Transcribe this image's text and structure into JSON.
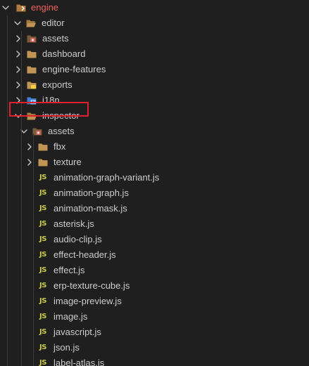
{
  "root": {
    "label": "engine",
    "color": "#f0605a"
  },
  "tree": [
    {
      "label": "editor",
      "chevron": "down",
      "icon": "folder-open-icon",
      "depth": 1
    },
    {
      "label": "assets",
      "chevron": "right",
      "icon": "assets-folder-icon",
      "depth": 2
    },
    {
      "label": "dashboard",
      "chevron": "right",
      "icon": "folder-icon",
      "depth": 2
    },
    {
      "label": "engine-features",
      "chevron": "right",
      "icon": "folder-icon",
      "depth": 2
    },
    {
      "label": "exports",
      "chevron": "right",
      "icon": "exports-folder-icon",
      "depth": 2
    },
    {
      "label": "i18n",
      "chevron": "right",
      "icon": "i18n-folder-icon",
      "depth": 2
    },
    {
      "label": "inspector",
      "chevron": "down",
      "icon": "folder-open-icon",
      "depth": 2,
      "highlighted": true
    },
    {
      "label": "assets",
      "chevron": "down",
      "icon": "assets-folder-icon",
      "depth": 3
    },
    {
      "label": "fbx",
      "chevron": "right",
      "icon": "folder-icon",
      "depth": 4
    },
    {
      "label": "texture",
      "chevron": "right",
      "icon": "folder-icon",
      "depth": 4
    },
    {
      "label": "animation-graph-variant.js",
      "icon": "js-file-icon",
      "depth": 4
    },
    {
      "label": "animation-graph.js",
      "icon": "js-file-icon",
      "depth": 4
    },
    {
      "label": "animation-mask.js",
      "icon": "js-file-icon",
      "depth": 4
    },
    {
      "label": "asterisk.js",
      "icon": "js-file-icon",
      "depth": 4
    },
    {
      "label": "audio-clip.js",
      "icon": "js-file-icon",
      "depth": 4
    },
    {
      "label": "effect-header.js",
      "icon": "js-file-icon",
      "depth": 4
    },
    {
      "label": "effect.js",
      "icon": "js-file-icon",
      "depth": 4
    },
    {
      "label": "erp-texture-cube.js",
      "icon": "js-file-icon",
      "depth": 4
    },
    {
      "label": "image-preview.js",
      "icon": "js-file-icon",
      "depth": 4
    },
    {
      "label": "image.js",
      "icon": "js-file-icon",
      "depth": 4
    },
    {
      "label": "javascript.js",
      "icon": "js-file-icon",
      "depth": 4
    },
    {
      "label": "json.js",
      "icon": "js-file-icon",
      "depth": 4
    },
    {
      "label": "label-atlas.js",
      "icon": "js-file-icon",
      "depth": 4
    }
  ],
  "js_icon_text": "JS",
  "colors": {
    "background": "#1f1f1f",
    "text": "#cccccc",
    "folder": "#c09553",
    "js": "#cbcb41",
    "highlight_border": "#e0202c"
  }
}
